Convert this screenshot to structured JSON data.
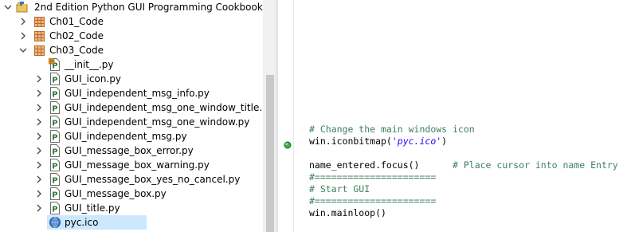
{
  "colors": {
    "selection": "#cce8ff",
    "comment": "#3f7f5f",
    "string": "#2a00ff",
    "folder": "#c8783c",
    "python_file_icon": "#2b7a3b"
  },
  "explorer": {
    "project": {
      "label": "2nd Edition Python GUI Programming Cookbook",
      "icon": "python-project-icon",
      "expanded": true
    },
    "folders": [
      {
        "label": "Ch01_Code",
        "icon": "package-icon",
        "expanded": false
      },
      {
        "label": "Ch02_Code",
        "icon": "package-icon",
        "expanded": false
      },
      {
        "label": "Ch03_Code",
        "icon": "package-icon",
        "expanded": true
      }
    ],
    "files": [
      {
        "label": "__init__.py",
        "icon": "init-file-icon",
        "has_twisty": false
      },
      {
        "label": "GUI_icon.py",
        "icon": "python-file-icon",
        "has_twisty": true
      },
      {
        "label": "GUI_independent_msg_info.py",
        "icon": "python-file-icon",
        "has_twisty": true
      },
      {
        "label": "GUI_independent_msg_one_window_title.py",
        "icon": "python-file-icon",
        "has_twisty": true
      },
      {
        "label": "GUI_independent_msg_one_window.py",
        "icon": "python-file-icon",
        "has_twisty": true
      },
      {
        "label": "GUI_independent_msg.py",
        "icon": "python-file-icon",
        "has_twisty": true
      },
      {
        "label": "GUI_message_box_error.py",
        "icon": "python-file-icon",
        "has_twisty": true
      },
      {
        "label": "GUI_message_box_warning.py",
        "icon": "python-file-icon",
        "has_twisty": true
      },
      {
        "label": "GUI_message_box_yes_no_cancel.py",
        "icon": "python-file-icon",
        "has_twisty": true
      },
      {
        "label": "GUI_message_box.py",
        "icon": "python-file-icon",
        "has_twisty": true
      },
      {
        "label": "GUI_title.py",
        "icon": "python-file-icon",
        "has_twisty": true
      },
      {
        "label": "pyc.ico",
        "icon": "ico-file-icon",
        "has_twisty": false,
        "selected": true
      }
    ]
  },
  "editor": {
    "lines": [
      {
        "parts": [
          {
            "text": "# Change the main windows icon",
            "kind": "comment"
          }
        ]
      },
      {
        "parts": [
          {
            "text": "win.iconbitmap(",
            "kind": "default"
          },
          {
            "text": "'pyc.ico'",
            "kind": "string"
          },
          {
            "text": ")",
            "kind": "default"
          }
        ],
        "breakpoint": true
      },
      {
        "parts": []
      },
      {
        "parts": [
          {
            "text": "name_entered.focus()      ",
            "kind": "default"
          },
          {
            "text": "# Place cursor into name Entry",
            "kind": "comment"
          }
        ]
      },
      {
        "parts": [
          {
            "text": "#======================",
            "kind": "comment"
          }
        ]
      },
      {
        "parts": [
          {
            "text": "# Start GUI",
            "kind": "comment"
          }
        ]
      },
      {
        "parts": [
          {
            "text": "#======================",
            "kind": "comment"
          }
        ]
      },
      {
        "parts": [
          {
            "text": "win.mainloop()",
            "kind": "default"
          }
        ]
      }
    ]
  }
}
